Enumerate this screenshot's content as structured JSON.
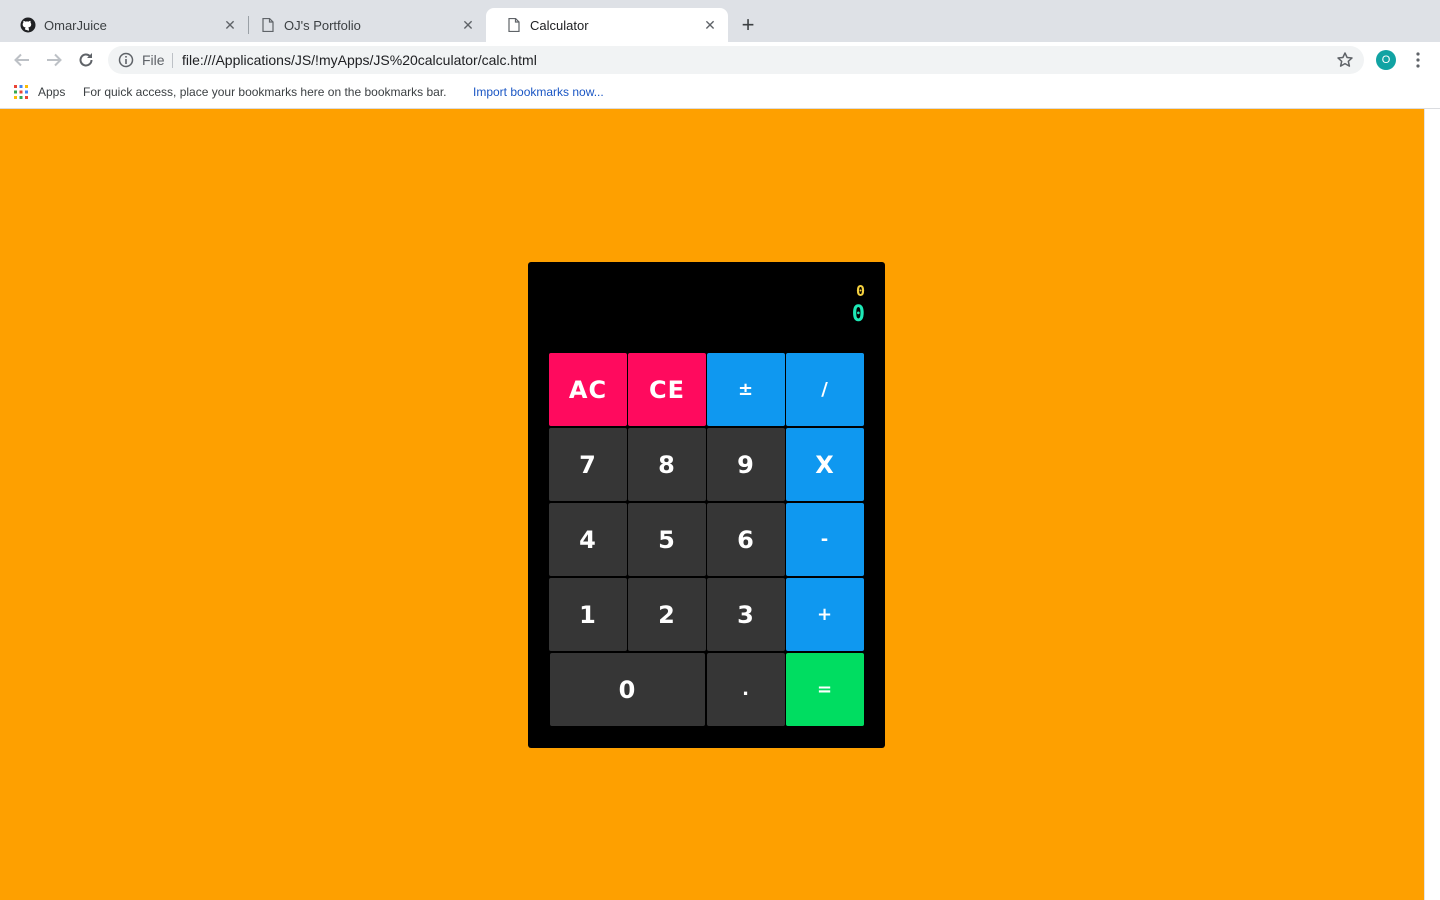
{
  "browser": {
    "tabs": [
      {
        "title": "OmarJuice",
        "icon": "github-icon",
        "active": false
      },
      {
        "title": "OJ's Portfolio",
        "icon": "page-icon",
        "active": false
      },
      {
        "title": "Calculator",
        "icon": "page-icon",
        "active": true
      }
    ],
    "omnibox": {
      "scheme_label": "File",
      "url": "file:///Applications/JS/!myApps/JS%20calculator/calc.html"
    },
    "avatar_letter": "O",
    "bookmarks": {
      "apps_label": "Apps",
      "hint": "For quick access, place your bookmarks here on the bookmarks bar.",
      "import_link": "Import bookmarks now..."
    }
  },
  "calculator": {
    "display": {
      "expression": "0",
      "result": "0"
    },
    "keys": {
      "ac": "AC",
      "ce": "CE",
      "plus_minus": "±",
      "divide": "/",
      "seven": "7",
      "eight": "8",
      "nine": "9",
      "multiply": "X",
      "four": "4",
      "five": "5",
      "six": "6",
      "minus": "-",
      "one": "1",
      "two": "2",
      "three": "3",
      "plus": "+",
      "zero": "0",
      "decimal": ".",
      "equals": "="
    }
  },
  "colors": {
    "page_background": "#fea000",
    "calculator_body": "#000000",
    "clear_keys": "#ff0a5e",
    "operator_keys": "#0f98f0",
    "digit_keys": "#363636",
    "equals_key": "#00dd61",
    "expression_text": "#f4d03f",
    "result_text": "#1de9b6"
  }
}
